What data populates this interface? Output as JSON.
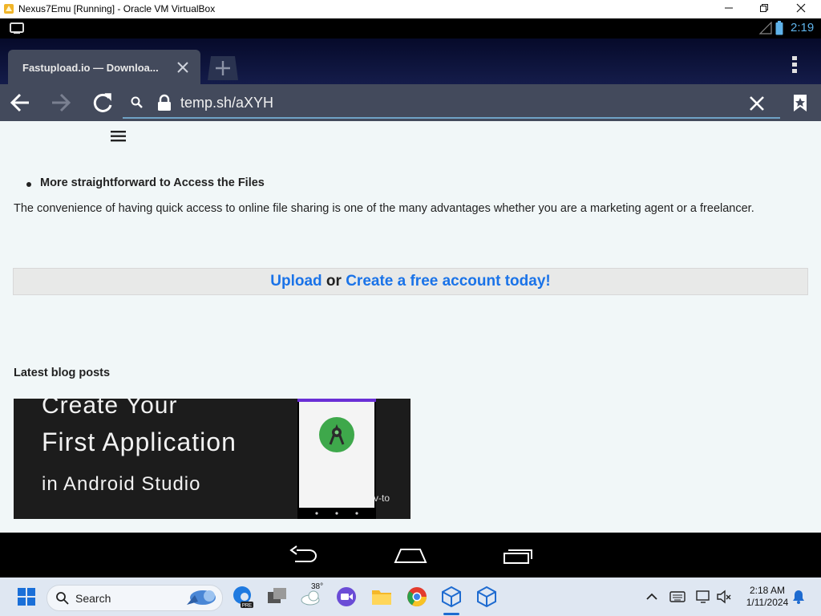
{
  "window": {
    "title": "Nexus7Emu [Running] - Oracle VM VirtualBox"
  },
  "status_bar": {
    "time": "2:19"
  },
  "browser": {
    "tab": {
      "title": "Fastupload.io — Downloa..."
    },
    "url": "temp.sh/aXYH"
  },
  "page": {
    "bullet_item": "More straightforward to Access the Files",
    "paragraph": "The convenience of having quick access to online file sharing is one of the many advantages whether you are a marketing agent or a freelancer.",
    "upload_bar": {
      "upload": "Upload",
      "or": "or",
      "create": "Create a free account today!"
    },
    "latest_blog_posts": "Latest blog posts",
    "blog_image": {
      "line1": "Create Your",
      "line2": "First Application",
      "line3": "in Android Studio",
      "overlay": "v-to"
    }
  },
  "taskbar": {
    "search_label": "Search",
    "weather_temp": "38°",
    "clock_time": "2:18 AM",
    "clock_date": "1/11/2024"
  },
  "colors": {
    "link": "#1a73e8",
    "toolbar": "#434a5c",
    "page_bg": "#f1f7f8",
    "status_time": "#5fb3ea"
  }
}
